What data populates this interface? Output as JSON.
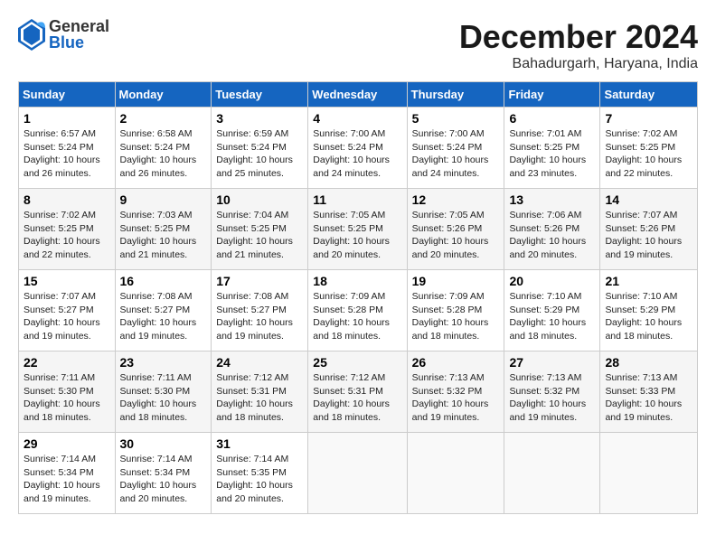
{
  "header": {
    "logo_general": "General",
    "logo_blue": "Blue",
    "month": "December 2024",
    "location": "Bahadurgarh, Haryana, India"
  },
  "weekdays": [
    "Sunday",
    "Monday",
    "Tuesday",
    "Wednesday",
    "Thursday",
    "Friday",
    "Saturday"
  ],
  "weeks": [
    [
      {
        "day": "1",
        "info": "Sunrise: 6:57 AM\nSunset: 5:24 PM\nDaylight: 10 hours\nand 26 minutes."
      },
      {
        "day": "2",
        "info": "Sunrise: 6:58 AM\nSunset: 5:24 PM\nDaylight: 10 hours\nand 26 minutes."
      },
      {
        "day": "3",
        "info": "Sunrise: 6:59 AM\nSunset: 5:24 PM\nDaylight: 10 hours\nand 25 minutes."
      },
      {
        "day": "4",
        "info": "Sunrise: 7:00 AM\nSunset: 5:24 PM\nDaylight: 10 hours\nand 24 minutes."
      },
      {
        "day": "5",
        "info": "Sunrise: 7:00 AM\nSunset: 5:24 PM\nDaylight: 10 hours\nand 24 minutes."
      },
      {
        "day": "6",
        "info": "Sunrise: 7:01 AM\nSunset: 5:25 PM\nDaylight: 10 hours\nand 23 minutes."
      },
      {
        "day": "7",
        "info": "Sunrise: 7:02 AM\nSunset: 5:25 PM\nDaylight: 10 hours\nand 22 minutes."
      }
    ],
    [
      {
        "day": "8",
        "info": "Sunrise: 7:02 AM\nSunset: 5:25 PM\nDaylight: 10 hours\nand 22 minutes."
      },
      {
        "day": "9",
        "info": "Sunrise: 7:03 AM\nSunset: 5:25 PM\nDaylight: 10 hours\nand 21 minutes."
      },
      {
        "day": "10",
        "info": "Sunrise: 7:04 AM\nSunset: 5:25 PM\nDaylight: 10 hours\nand 21 minutes."
      },
      {
        "day": "11",
        "info": "Sunrise: 7:05 AM\nSunset: 5:25 PM\nDaylight: 10 hours\nand 20 minutes."
      },
      {
        "day": "12",
        "info": "Sunrise: 7:05 AM\nSunset: 5:26 PM\nDaylight: 10 hours\nand 20 minutes."
      },
      {
        "day": "13",
        "info": "Sunrise: 7:06 AM\nSunset: 5:26 PM\nDaylight: 10 hours\nand 20 minutes."
      },
      {
        "day": "14",
        "info": "Sunrise: 7:07 AM\nSunset: 5:26 PM\nDaylight: 10 hours\nand 19 minutes."
      }
    ],
    [
      {
        "day": "15",
        "info": "Sunrise: 7:07 AM\nSunset: 5:27 PM\nDaylight: 10 hours\nand 19 minutes."
      },
      {
        "day": "16",
        "info": "Sunrise: 7:08 AM\nSunset: 5:27 PM\nDaylight: 10 hours\nand 19 minutes."
      },
      {
        "day": "17",
        "info": "Sunrise: 7:08 AM\nSunset: 5:27 PM\nDaylight: 10 hours\nand 19 minutes."
      },
      {
        "day": "18",
        "info": "Sunrise: 7:09 AM\nSunset: 5:28 PM\nDaylight: 10 hours\nand 18 minutes."
      },
      {
        "day": "19",
        "info": "Sunrise: 7:09 AM\nSunset: 5:28 PM\nDaylight: 10 hours\nand 18 minutes."
      },
      {
        "day": "20",
        "info": "Sunrise: 7:10 AM\nSunset: 5:29 PM\nDaylight: 10 hours\nand 18 minutes."
      },
      {
        "day": "21",
        "info": "Sunrise: 7:10 AM\nSunset: 5:29 PM\nDaylight: 10 hours\nand 18 minutes."
      }
    ],
    [
      {
        "day": "22",
        "info": "Sunrise: 7:11 AM\nSunset: 5:30 PM\nDaylight: 10 hours\nand 18 minutes."
      },
      {
        "day": "23",
        "info": "Sunrise: 7:11 AM\nSunset: 5:30 PM\nDaylight: 10 hours\nand 18 minutes."
      },
      {
        "day": "24",
        "info": "Sunrise: 7:12 AM\nSunset: 5:31 PM\nDaylight: 10 hours\nand 18 minutes."
      },
      {
        "day": "25",
        "info": "Sunrise: 7:12 AM\nSunset: 5:31 PM\nDaylight: 10 hours\nand 18 minutes."
      },
      {
        "day": "26",
        "info": "Sunrise: 7:13 AM\nSunset: 5:32 PM\nDaylight: 10 hours\nand 19 minutes."
      },
      {
        "day": "27",
        "info": "Sunrise: 7:13 AM\nSunset: 5:32 PM\nDaylight: 10 hours\nand 19 minutes."
      },
      {
        "day": "28",
        "info": "Sunrise: 7:13 AM\nSunset: 5:33 PM\nDaylight: 10 hours\nand 19 minutes."
      }
    ],
    [
      {
        "day": "29",
        "info": "Sunrise: 7:14 AM\nSunset: 5:34 PM\nDaylight: 10 hours\nand 19 minutes."
      },
      {
        "day": "30",
        "info": "Sunrise: 7:14 AM\nSunset: 5:34 PM\nDaylight: 10 hours\nand 20 minutes."
      },
      {
        "day": "31",
        "info": "Sunrise: 7:14 AM\nSunset: 5:35 PM\nDaylight: 10 hours\nand 20 minutes."
      },
      {
        "day": "",
        "info": ""
      },
      {
        "day": "",
        "info": ""
      },
      {
        "day": "",
        "info": ""
      },
      {
        "day": "",
        "info": ""
      }
    ]
  ]
}
